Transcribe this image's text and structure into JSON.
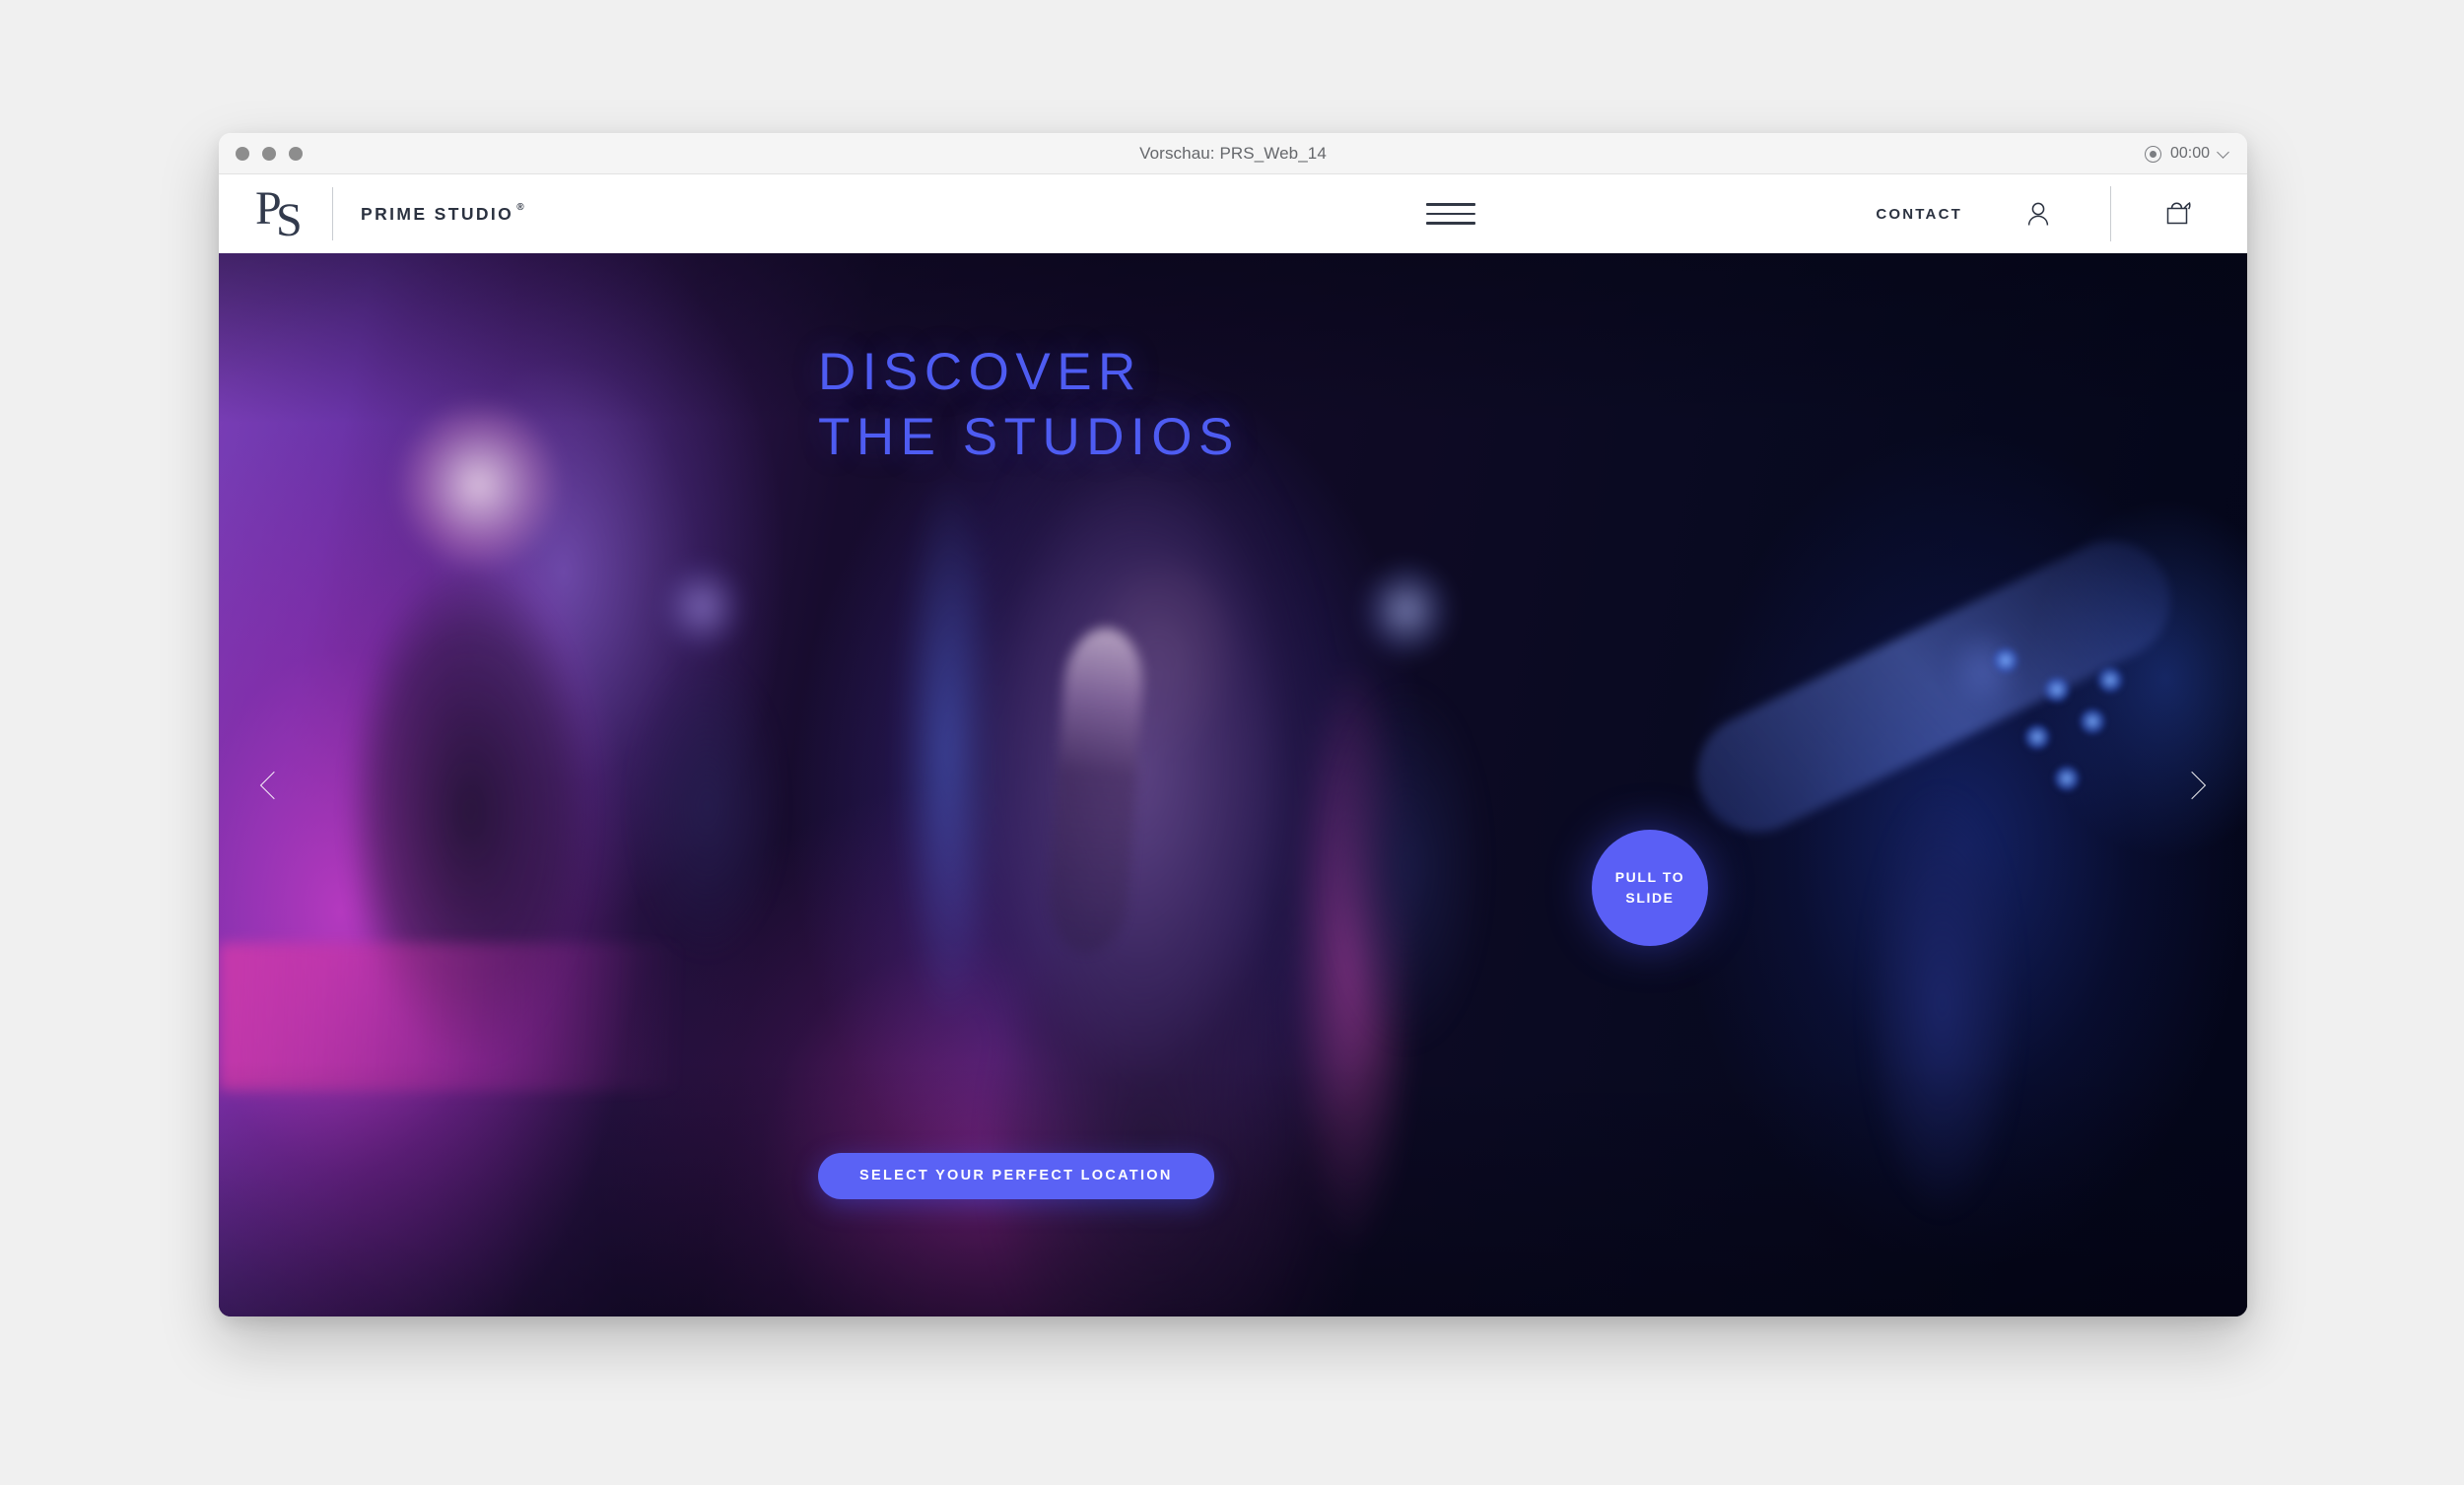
{
  "window": {
    "title": "Vorschau: PRS_Web_14",
    "timer": "00:00",
    "rec_icon": "record-icon",
    "chevron_icon": "chevron-down-icon",
    "traffic_lights": [
      "close",
      "minimize",
      "zoom"
    ]
  },
  "nav": {
    "logo_mark": "prime-studio-monogram",
    "brand_name": "PRIME STUDIO",
    "brand_registered": "®",
    "menu_icon": "hamburger-menu-icon",
    "contact_label": "CONTACT",
    "account_icon": "user-account-icon",
    "cart_icon": "shopping-bag-icon"
  },
  "hero": {
    "headline": "DISCOVER\nTHE STUDIOS",
    "cta_label": "SELECT YOUR PERFECT LOCATION",
    "pull_label": "PULL TO\nSLIDE",
    "prev_icon": "chevron-left-icon",
    "next_icon": "chevron-right-icon",
    "image_alt": "band performing in neon-lit studio"
  },
  "colors": {
    "accent": "#5a62f5",
    "headline": "#4e5cf2",
    "brand_dark": "#2b3240",
    "titlebar": "#f5f5f5",
    "page_bg": "#f0f0f0"
  }
}
